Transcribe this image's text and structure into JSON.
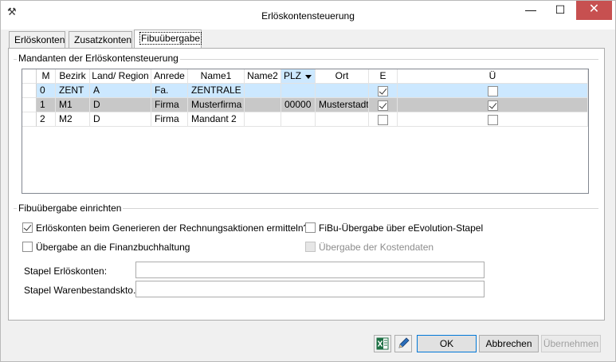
{
  "window": {
    "title": "Erlöskontensteuerung",
    "minimize": "—",
    "maximize": "☐",
    "close": "✕"
  },
  "tabs": [
    {
      "label": "Erlöskonten"
    },
    {
      "label": "Zusatzkonten"
    },
    {
      "label": "Fibuübergabe"
    }
  ],
  "mandanten_group": {
    "title": "Mandanten der Erlöskontensteuerung"
  },
  "grid": {
    "headers": {
      "m": "M",
      "bezirk": "Bezirk",
      "land": "Land/ Region",
      "anrede": "Anrede",
      "name1": "Name1",
      "name2": "Name2",
      "plz": "PLZ",
      "ort": "Ort",
      "e": "E",
      "u": "Ü"
    },
    "rows": [
      {
        "m": "0",
        "bezirk": "ZENT",
        "land": "A",
        "anrede": "Fa.",
        "name1": "ZENTRALE",
        "name2": "",
        "plz": "",
        "ort": "",
        "e": true,
        "u": false
      },
      {
        "m": "1",
        "bezirk": "M1",
        "land": "D",
        "anrede": "Firma",
        "name1": "Musterfirma",
        "name2": "",
        "plz": "00000",
        "ort": "Musterstadt",
        "e": true,
        "u": true
      },
      {
        "m": "2",
        "bezirk": "M2",
        "land": "D",
        "anrede": "Firma",
        "name1": "Mandant 2",
        "name2": "",
        "plz": "",
        "ort": "",
        "e": false,
        "u": false
      }
    ]
  },
  "fibu_group": {
    "title": "Fibuübergabe einrichten",
    "opt_erloeskonten": {
      "label": "Erlöskonten beim Generieren der Rechnungsaktionen ermitteln?",
      "checked": true
    },
    "opt_finanzbuchhaltung": {
      "label": "Übergabe an die Finanzbuchhaltung",
      "checked": false
    },
    "opt_eevolution": {
      "label": "FiBu-Übergabe über eEvolution-Stapel",
      "checked": false
    },
    "opt_kostendaten": {
      "label": "Übergabe der Kostendaten",
      "checked": false
    },
    "stapel_erloeskonten_label": "Stapel Erlöskonten:",
    "stapel_erloeskonten_value": "",
    "stapel_warenbestand_label": "Stapel Warenbestandskto.:",
    "stapel_warenbestand_value": ""
  },
  "buttons": {
    "excel_icon": "excel-icon",
    "edit_icon": "pencil-icon",
    "ok": "OK",
    "cancel": "Abbrechen",
    "apply": "Übernehmen"
  },
  "colors": {
    "selected_row": "#cce8ff",
    "alt_row": "#c8c8c8",
    "close_button": "#c75050",
    "default_button_border": "#0078d7"
  }
}
